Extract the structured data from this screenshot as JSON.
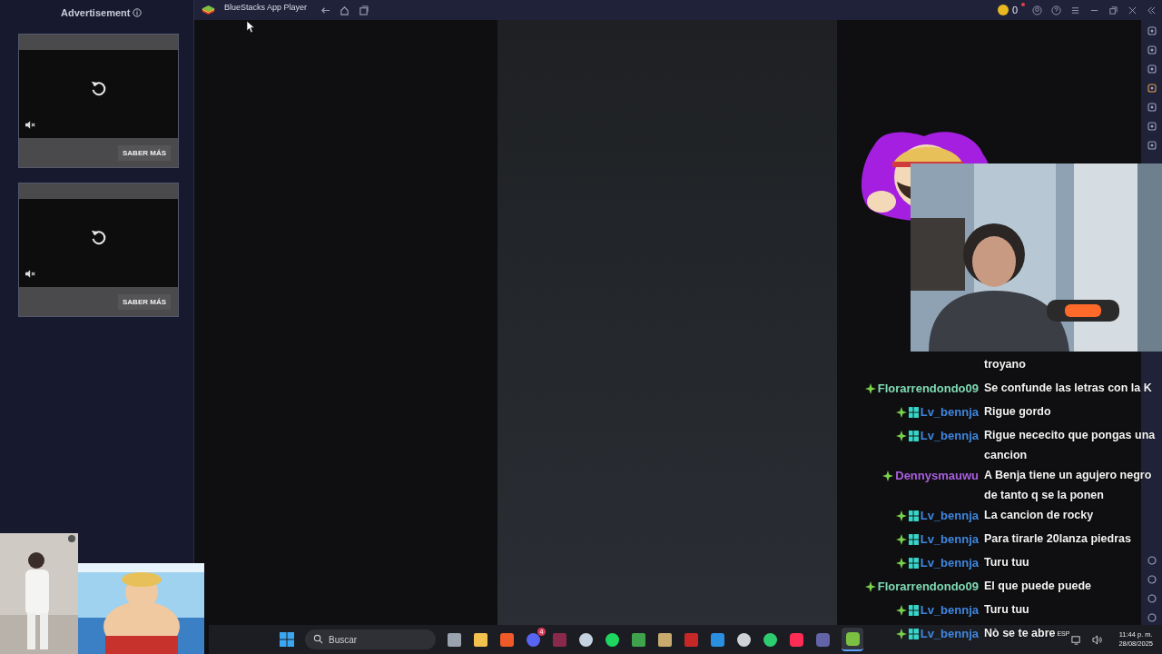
{
  "ad_panel": {
    "title": "Advertisement",
    "ads": [
      {
        "button": "SABER MÁS"
      },
      {
        "button": "SABER MÁS"
      }
    ]
  },
  "window": {
    "title": "BlueStacks App Player",
    "coins": "0"
  },
  "chat": [
    {
      "kind": "continuation",
      "message": "troyano"
    },
    {
      "kind": "message",
      "user": "Florarrendondo09",
      "color": "#7fdab4",
      "badge": false,
      "message": "Se confunde las letras con la K"
    },
    {
      "kind": "message",
      "user": "Lv_bennja",
      "color": "#3f86e0",
      "badge": true,
      "message": "Rigue gordo"
    },
    {
      "kind": "message",
      "user": "Lv_bennja",
      "color": "#3f86e0",
      "badge": true,
      "message": "Rigue nececito que pongas una cancion"
    },
    {
      "kind": "message",
      "user": "Dennysmauwu",
      "color": "#a95fe0",
      "badge": false,
      "message": "A Benja tiene un agujero negro de tanto q se la ponen"
    },
    {
      "kind": "message",
      "user": "Lv_bennja",
      "color": "#3f86e0",
      "badge": true,
      "message": "La cancion de rocky"
    },
    {
      "kind": "message",
      "user": "Lv_bennja",
      "color": "#3f86e0",
      "badge": true,
      "message": "Para tirarle 20lanza piedras"
    },
    {
      "kind": "message",
      "user": "Lv_bennja",
      "color": "#3f86e0",
      "badge": true,
      "message": "Turu tuu"
    },
    {
      "kind": "message",
      "user": "Florarrendondo09",
      "color": "#7fdab4",
      "badge": false,
      "message": "El que puede puede"
    },
    {
      "kind": "message",
      "user": "Lv_bennja",
      "color": "#3f86e0",
      "badge": true,
      "message": "Turu tuu"
    },
    {
      "kind": "message",
      "user": "Lv_bennja",
      "color": "#3f86e0",
      "badge": true,
      "message": "Nò se te abre"
    }
  ],
  "taskbar": {
    "search": {
      "placeholder": "Buscar"
    },
    "notification_count": "4",
    "language": "ESP",
    "time": "11:44 p. m.",
    "date": "28/08/2025"
  }
}
